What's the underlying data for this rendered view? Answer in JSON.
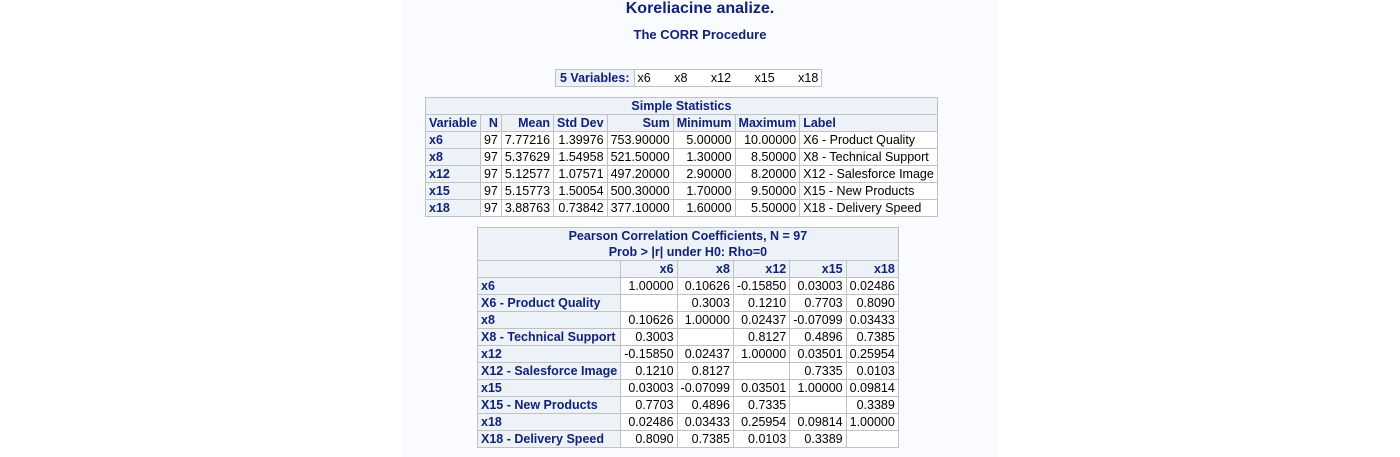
{
  "title": "Koreliacine analize.",
  "subtitle": "The CORR Procedure",
  "variables": {
    "label": "5  Variables:",
    "names": [
      "x6",
      "x8",
      "x12",
      "x15",
      "x18"
    ]
  },
  "simple_statistics": {
    "caption": "Simple Statistics",
    "columns": [
      "Variable",
      "N",
      "Mean",
      "Std Dev",
      "Sum",
      "Minimum",
      "Maximum",
      "Label"
    ],
    "rows": [
      [
        "x6",
        "97",
        "7.77216",
        "1.39976",
        "753.90000",
        "5.00000",
        "10.00000",
        "X6 - Product Quality"
      ],
      [
        "x8",
        "97",
        "5.37629",
        "1.54958",
        "521.50000",
        "1.30000",
        "8.50000",
        "X8 - Technical Support"
      ],
      [
        "x12",
        "97",
        "5.12577",
        "1.07571",
        "497.20000",
        "2.90000",
        "8.20000",
        "X12 - Salesforce Image"
      ],
      [
        "x15",
        "97",
        "5.15773",
        "1.50054",
        "500.30000",
        "1.70000",
        "9.50000",
        "X15 - New Products"
      ],
      [
        "x18",
        "97",
        "3.88763",
        "0.73842",
        "377.10000",
        "1.60000",
        "5.50000",
        "X18 - Delivery Speed"
      ]
    ]
  },
  "correlation": {
    "caption_line1": "Pearson Correlation Coefficients, N = 97",
    "caption_line2": "Prob > |r| under H0: Rho=0",
    "columns": [
      "x6",
      "x8",
      "x12",
      "x15",
      "x18"
    ],
    "rows": [
      {
        "var": "x6",
        "label": "X6 - Product Quality",
        "r": [
          "1.00000",
          "0.10626",
          "-0.15850",
          "0.03003",
          "0.02486"
        ],
        "p": [
          "",
          "0.3003",
          "0.1210",
          "0.7703",
          "0.8090"
        ]
      },
      {
        "var": "x8",
        "label": "X8 - Technical Support",
        "r": [
          "0.10626",
          "1.00000",
          "0.02437",
          "-0.07099",
          "0.03433"
        ],
        "p": [
          "0.3003",
          "",
          "0.8127",
          "0.4896",
          "0.7385"
        ]
      },
      {
        "var": "x12",
        "label": "X12 - Salesforce Image",
        "r": [
          "-0.15850",
          "0.02437",
          "1.00000",
          "0.03501",
          "0.25954"
        ],
        "p": [
          "0.1210",
          "0.8127",
          "",
          "0.7335",
          "0.0103"
        ]
      },
      {
        "var": "x15",
        "label": "X15 - New Products",
        "r": [
          "0.03003",
          "-0.07099",
          "0.03501",
          "1.00000",
          "0.09814"
        ],
        "p": [
          "0.7703",
          "0.4896",
          "0.7335",
          "",
          "0.3389"
        ]
      },
      {
        "var": "x18",
        "label": "X18 - Delivery Speed",
        "r": [
          "0.02486",
          "0.03433",
          "0.25954",
          "0.09814",
          "1.00000"
        ],
        "p": [
          "0.8090",
          "0.7385",
          "0.0103",
          "0.3389",
          ""
        ]
      }
    ]
  }
}
